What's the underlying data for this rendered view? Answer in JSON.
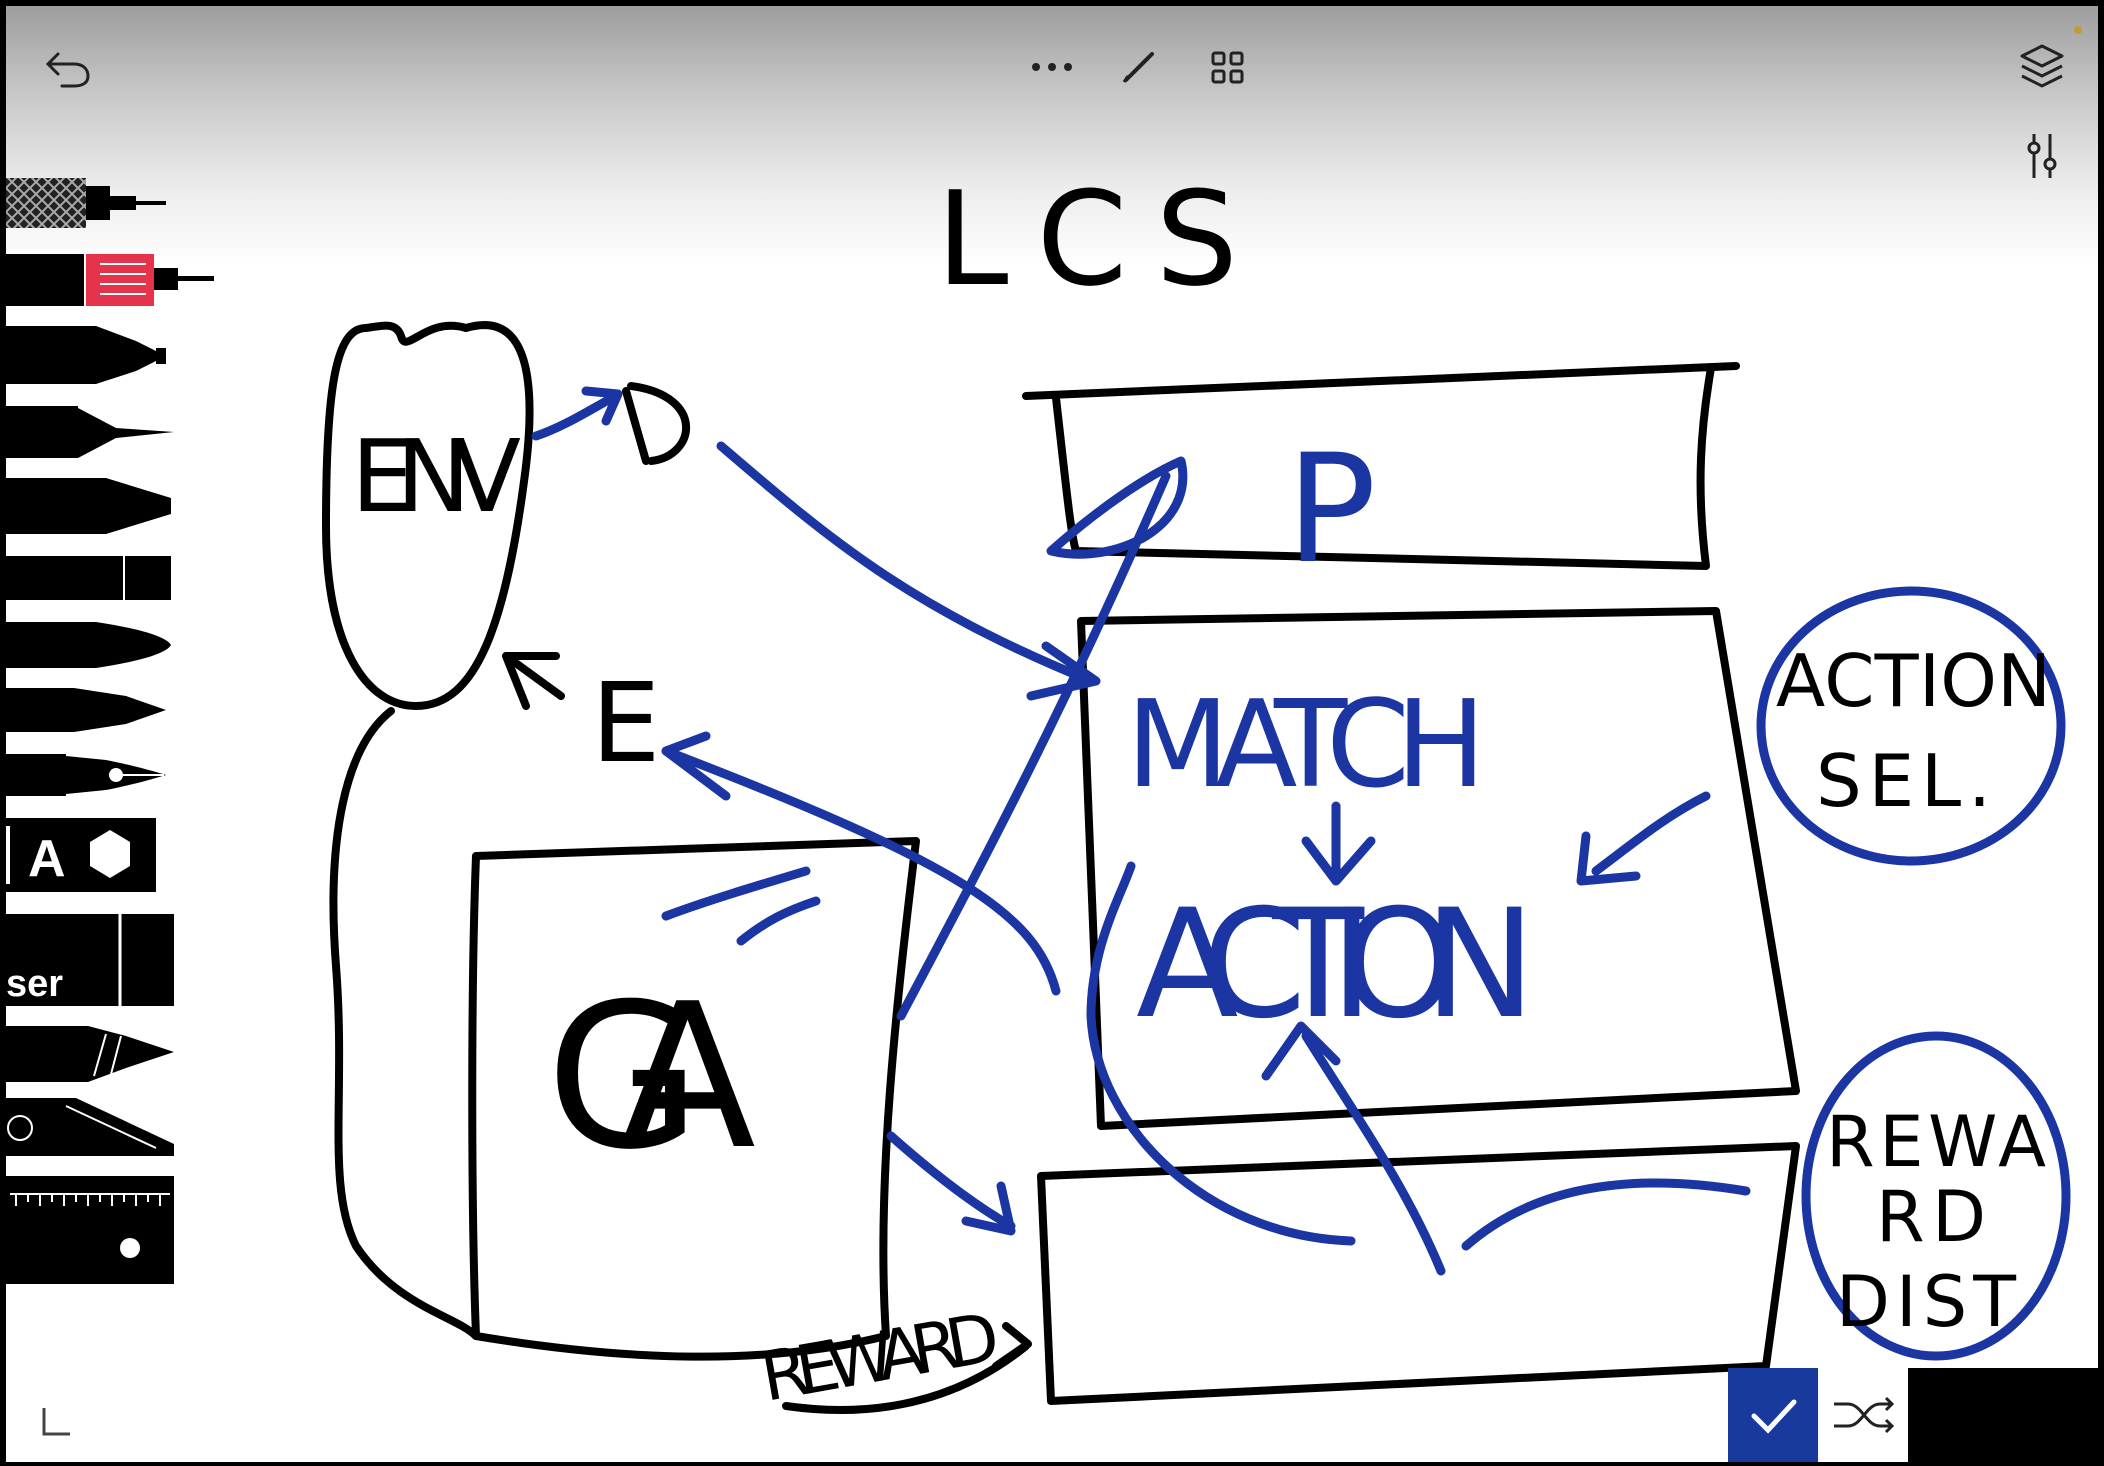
{
  "toolbar": {
    "undo_icon": "undo-arrow-icon",
    "more_icon": "ellipsis-icon",
    "pencil_icon": "pencil-icon",
    "grid_icon": "grid-icon",
    "layers_icon": "layers-icon",
    "adjust_icon": "sliders-icon"
  },
  "brush_palette": {
    "text_tool_label": "A",
    "eraser_label": "ser"
  },
  "canvas": {
    "title": "LCS",
    "env_label": "ENV",
    "e_label": "E",
    "ga_label": "GA",
    "reward_label": "REWARD",
    "p_label": "P",
    "match_label": "MATCH",
    "action_label": "ACTION",
    "action_sel_line1": "ACTION",
    "action_sel_line2": "SEL.",
    "reward_dist_line1": "REWA",
    "reward_dist_line2": "RD",
    "reward_dist_line3": "DIST"
  },
  "colors": {
    "ink_black": "#000000",
    "ink_blue": "#1b35a3",
    "accent_confirm": "#173a9c",
    "pencil_red": "#e5334b"
  },
  "bottom_bar": {
    "confirm_icon": "checkmark-icon",
    "shuffle_icon": "shuffle-icon",
    "corner_icon": "corner-icon"
  }
}
